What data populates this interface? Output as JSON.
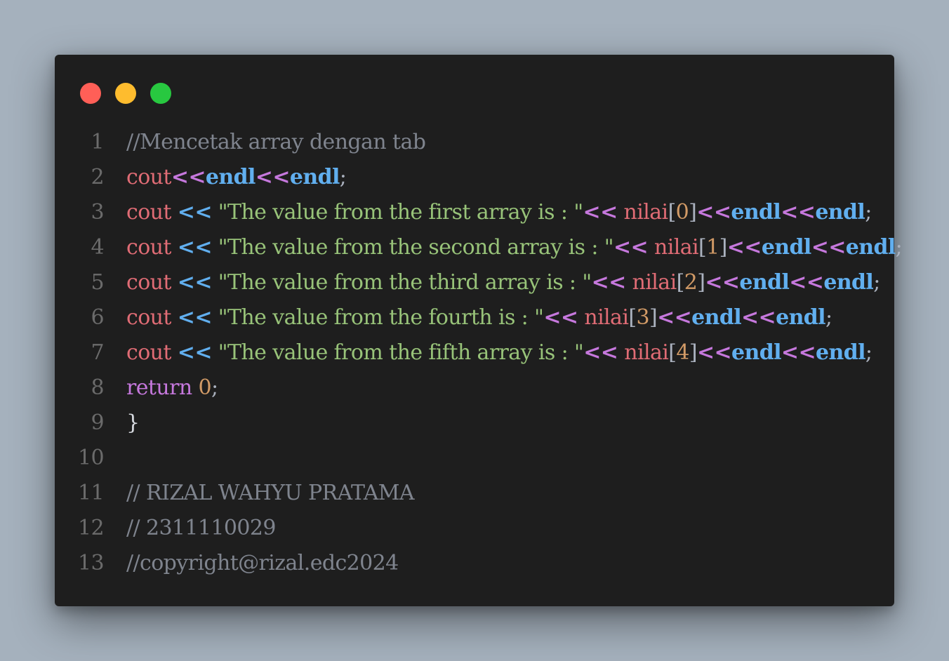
{
  "window": {
    "buttons": [
      {
        "name": "close",
        "color": "#ff5f57"
      },
      {
        "name": "minimize",
        "color": "#febc2e"
      },
      {
        "name": "zoom",
        "color": "#28c840"
      }
    ]
  },
  "colors": {
    "background": "#a5b1bd",
    "editor": "#1e1e1e",
    "comment": "#7f848e",
    "identifier": "#e06c75",
    "operator_blue": "#61afef",
    "operator_purple": "#c678dd",
    "string": "#98c379",
    "number": "#d19a66"
  },
  "lines": [
    {
      "num": "1",
      "tokens": [
        {
          "t": "comment",
          "v": "//Mencetak array dengan tab"
        }
      ]
    },
    {
      "num": "2",
      "tokens": [
        {
          "t": "ident",
          "v": "cout"
        },
        {
          "t": "op2",
          "v": "<<"
        },
        {
          "t": "endl",
          "v": "endl"
        },
        {
          "t": "op2",
          "v": "<<"
        },
        {
          "t": "endl",
          "v": "endl"
        },
        {
          "t": "punct",
          "v": ";"
        }
      ]
    },
    {
      "num": "3",
      "tokens": [
        {
          "t": "ident",
          "v": "cout "
        },
        {
          "t": "op",
          "v": "<<"
        },
        {
          "t": "string",
          "v": " \"The value from the first array is : \""
        },
        {
          "t": "op2",
          "v": "<<"
        },
        {
          "t": "ident",
          "v": " nilai"
        },
        {
          "t": "punct",
          "v": "["
        },
        {
          "t": "number",
          "v": "0"
        },
        {
          "t": "punct",
          "v": "]"
        },
        {
          "t": "op2",
          "v": "<<"
        },
        {
          "t": "endl",
          "v": "endl"
        },
        {
          "t": "op2",
          "v": "<<"
        },
        {
          "t": "endl",
          "v": "endl"
        },
        {
          "t": "punct",
          "v": ";"
        }
      ]
    },
    {
      "num": "4",
      "tokens": [
        {
          "t": "ident",
          "v": "cout "
        },
        {
          "t": "op",
          "v": "<<"
        },
        {
          "t": "string",
          "v": " \"The value from the second array is : \""
        },
        {
          "t": "op2",
          "v": "<<"
        },
        {
          "t": "ident",
          "v": " nilai"
        },
        {
          "t": "punct",
          "v": "["
        },
        {
          "t": "number",
          "v": "1"
        },
        {
          "t": "punct",
          "v": "]"
        },
        {
          "t": "op2",
          "v": "<<"
        },
        {
          "t": "endl",
          "v": "endl"
        },
        {
          "t": "op2",
          "v": "<<"
        },
        {
          "t": "endl",
          "v": "endl"
        },
        {
          "t": "punct",
          "v": ";"
        }
      ]
    },
    {
      "num": "5",
      "tokens": [
        {
          "t": "ident",
          "v": "cout "
        },
        {
          "t": "op",
          "v": "<<"
        },
        {
          "t": "string",
          "v": " \"The value from the third array is : \""
        },
        {
          "t": "op2",
          "v": "<<"
        },
        {
          "t": "ident",
          "v": " nilai"
        },
        {
          "t": "punct",
          "v": "["
        },
        {
          "t": "number",
          "v": "2"
        },
        {
          "t": "punct",
          "v": "]"
        },
        {
          "t": "op2",
          "v": "<<"
        },
        {
          "t": "endl",
          "v": "endl"
        },
        {
          "t": "op2",
          "v": "<<"
        },
        {
          "t": "endl",
          "v": "endl"
        },
        {
          "t": "punct",
          "v": ";"
        }
      ]
    },
    {
      "num": "6",
      "tokens": [
        {
          "t": "ident",
          "v": "cout "
        },
        {
          "t": "op",
          "v": "<<"
        },
        {
          "t": "string",
          "v": " \"The value from the fourth is : \""
        },
        {
          "t": "op2",
          "v": "<<"
        },
        {
          "t": "ident",
          "v": " nilai"
        },
        {
          "t": "punct",
          "v": "["
        },
        {
          "t": "number",
          "v": "3"
        },
        {
          "t": "punct",
          "v": "]"
        },
        {
          "t": "op2",
          "v": "<<"
        },
        {
          "t": "endl",
          "v": "endl"
        },
        {
          "t": "op2",
          "v": "<<"
        },
        {
          "t": "endl",
          "v": "endl"
        },
        {
          "t": "punct",
          "v": ";"
        }
      ]
    },
    {
      "num": "7",
      "tokens": [
        {
          "t": "ident",
          "v": "cout "
        },
        {
          "t": "op",
          "v": "<<"
        },
        {
          "t": "string",
          "v": " \"The value from the fifth array is : \""
        },
        {
          "t": "op2",
          "v": "<<"
        },
        {
          "t": "ident",
          "v": " nilai"
        },
        {
          "t": "punct",
          "v": "["
        },
        {
          "t": "number",
          "v": "4"
        },
        {
          "t": "punct",
          "v": "]"
        },
        {
          "t": "op2",
          "v": "<<"
        },
        {
          "t": "endl",
          "v": "endl"
        },
        {
          "t": "op2",
          "v": "<<"
        },
        {
          "t": "endl",
          "v": "endl"
        },
        {
          "t": "punct",
          "v": ";"
        }
      ]
    },
    {
      "num": "8",
      "tokens": [
        {
          "t": "keyword",
          "v": "return "
        },
        {
          "t": "number",
          "v": "0"
        },
        {
          "t": "punct",
          "v": ";"
        }
      ]
    },
    {
      "num": "9",
      "tokens": [
        {
          "t": "plain",
          "v": "}"
        }
      ]
    },
    {
      "num": "10",
      "tokens": []
    },
    {
      "num": "11",
      "tokens": [
        {
          "t": "comment",
          "v": "// RIZAL WAHYU PRATAMA"
        }
      ]
    },
    {
      "num": "12",
      "tokens": [
        {
          "t": "comment",
          "v": "// 2311110029"
        }
      ]
    },
    {
      "num": "13",
      "tokens": [
        {
          "t": "comment",
          "v": "//copyright@rizal.edc2024"
        }
      ]
    }
  ]
}
